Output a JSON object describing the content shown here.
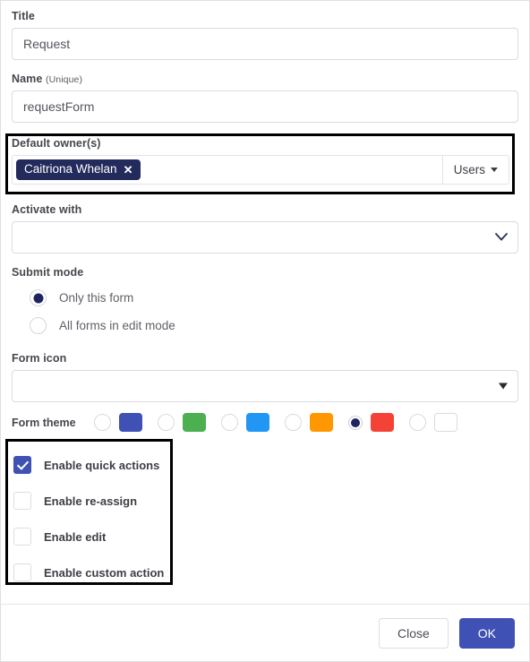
{
  "fields": {
    "title": {
      "label": "Title",
      "value": "Request"
    },
    "name": {
      "label": "Name",
      "label_sub": "(Unique)",
      "value": "requestForm"
    },
    "default_owners": {
      "label": "Default owner(s)",
      "chips": [
        {
          "name": "Caitriona Whelan",
          "remove_icon": "✕"
        }
      ],
      "dropdown_label": "Users"
    },
    "activate_with": {
      "label": "Activate with",
      "value": ""
    },
    "submit_mode": {
      "label": "Submit mode",
      "options": [
        {
          "label": "Only this form",
          "selected": true
        },
        {
          "label": "All forms in edit mode",
          "selected": false
        }
      ]
    },
    "form_icon": {
      "label": "Form icon",
      "value": ""
    },
    "form_theme": {
      "label": "Form theme",
      "options": [
        {
          "color": "#3f51b5",
          "selected": false
        },
        {
          "color": "#4caf50",
          "selected": false
        },
        {
          "color": "#2196f3",
          "selected": false
        },
        {
          "color": "#ff9800",
          "selected": false
        },
        {
          "color": "#f44336",
          "selected": true
        },
        {
          "color": "#ffffff",
          "selected": false
        }
      ]
    },
    "options": {
      "items": [
        {
          "label": "Enable quick actions",
          "checked": true
        },
        {
          "label": "Enable re-assign",
          "checked": false
        },
        {
          "label": "Enable edit",
          "checked": false
        },
        {
          "label": "Enable custom action",
          "checked": false
        }
      ]
    }
  },
  "footer": {
    "close_label": "Close",
    "ok_label": "OK"
  },
  "colors": {
    "accent": "#3f51b5",
    "chip_bg": "#232a5c",
    "radio_dot": "#1d2560",
    "highlight": "#000000"
  }
}
